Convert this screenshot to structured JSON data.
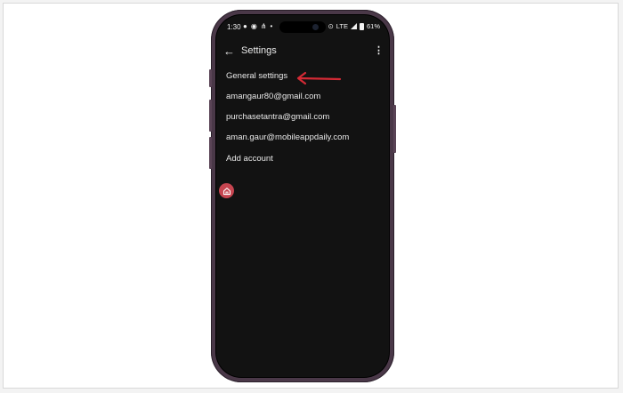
{
  "status_bar": {
    "time": "1:30",
    "left_icons": [
      "signal-app-icon",
      "messenger-icon",
      "share-icon",
      "dot-icon"
    ],
    "network": "LTE",
    "battery": "61%"
  },
  "app_bar": {
    "title": "Settings",
    "back_icon": "arrow-left-icon",
    "more_icon": "more-vert-icon"
  },
  "settings_items": [
    "General settings",
    "amangaur80@gmail.com",
    "purchasetantra@gmail.com",
    "aman.gaur@mobileappdaily.com",
    "Add account"
  ],
  "annotation": {
    "color": "#d42a35",
    "icon": "red-arrow-icon"
  },
  "floating_bubble": {
    "color": "#c64550",
    "icon": "home-bubble-icon"
  },
  "colors": {
    "screen_bg": "#121212",
    "phone_frame": "#4a3848",
    "text": "#e8e8e8"
  }
}
